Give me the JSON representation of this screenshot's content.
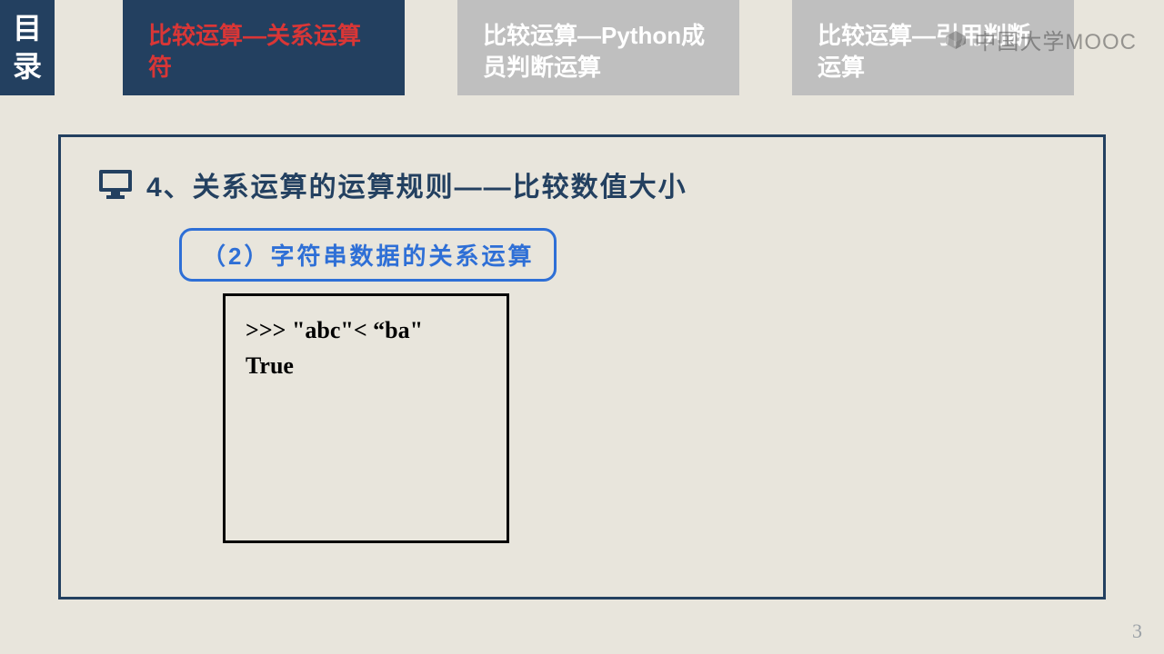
{
  "sidebar": {
    "char1": "目",
    "char2": "录"
  },
  "tabs": [
    {
      "label": "比较运算—关系运算符",
      "active": true
    },
    {
      "label": "比较运算—Python成员判断运算",
      "active": false
    },
    {
      "label": "比较运算—引用判断运算",
      "active": false
    }
  ],
  "watermark": "中国大学MOOC",
  "heading": "4、关系运算的运算规则——比较数值大小",
  "subheading": "（2）字符串数据的关系运算",
  "code": {
    "line1": ">>> \"abc\"< “ba\"",
    "line2": "True"
  },
  "page_number": "3"
}
